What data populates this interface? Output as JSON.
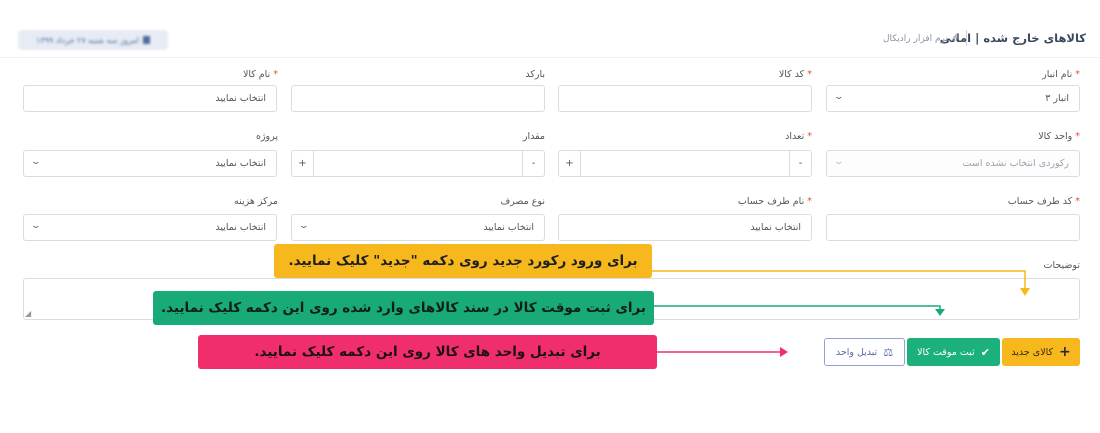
{
  "header": {
    "title": "کالاهای خارج شده | امانی",
    "breadcrumb_hash": "#",
    "breadcrumb_text": "نرم افزار رادیکال",
    "date_text": "امروز سه شنبه ۲۷ خرداد ۱۳۹۹"
  },
  "form": {
    "warehouse": {
      "label": "نام انبار",
      "value": "انبار ۳"
    },
    "item_code": {
      "label": "کد کالا",
      "value": ""
    },
    "barcode": {
      "label": "بارکد",
      "value": ""
    },
    "item_name": {
      "label": "نام کالا",
      "value": "انتخاب نمایید"
    },
    "unit": {
      "label": "واحد کالا",
      "value": "رکوردی انتخاب نشده است"
    },
    "count": {
      "label": "تعداد",
      "value": ""
    },
    "amount": {
      "label": "مقدار",
      "value": ""
    },
    "project": {
      "label": "پروژه",
      "value": "انتخاب نمایید"
    },
    "account_code": {
      "label": "کد طرف حساب",
      "value": ""
    },
    "account_name": {
      "label": "نام طرف حساب",
      "value": "انتخاب نمایید"
    },
    "usage_type": {
      "label": "نوع مصرف",
      "value": "انتخاب نمایید"
    },
    "cost_center": {
      "label": "مرکز هزینه",
      "value": "انتخاب نمایید"
    },
    "description": {
      "label": "توضیحات",
      "value": ""
    },
    "required_mark": "*",
    "stepper_plus": "+",
    "stepper_minus": "-"
  },
  "actions": {
    "new_label": "کالای جدید",
    "save_label": "ثبت موقت کالا",
    "convert_label": "تبدیل واحد"
  },
  "callouts": {
    "new_hint": "برای ورود رکورد جدید روی دکمه \"جدید\" کلیک نمایید.",
    "save_hint": "برای ثبت موقت کالا در سند کالاهای وارد شده روی این دکمه کلیک نمایید.",
    "convert_hint": "برای تبدیل واحد های کالا روی این دکمه کلیک نمایید."
  },
  "colors": {
    "yellow": "#f6b81c",
    "green": "#1cb07a",
    "pink": "#f02e6c",
    "required": "#e74c3c"
  },
  "icons": {
    "chevron": "chevron-down-icon",
    "plus": "plus-icon",
    "check": "check-icon",
    "convert": "convert-units-icon",
    "calendar": "calendar-icon"
  }
}
